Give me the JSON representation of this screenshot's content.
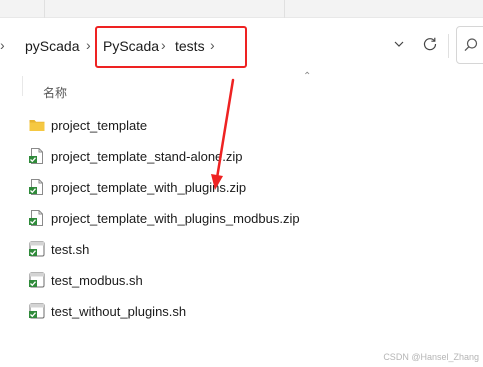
{
  "address_bar": {
    "crumbs": [
      "pyScada",
      "PyScada",
      "tests"
    ],
    "separator": "›"
  },
  "file_list": {
    "column_header": "名称",
    "items": [
      {
        "name": "project_template",
        "icon": "folder-icon"
      },
      {
        "name": "project_template_stand-alone.zip",
        "icon": "zip-archive-icon"
      },
      {
        "name": "project_template_with_plugins.zip",
        "icon": "zip-archive-icon"
      },
      {
        "name": "project_template_with_plugins_modbus.zip",
        "icon": "zip-archive-icon"
      },
      {
        "name": "test.sh",
        "icon": "shell-script-icon"
      },
      {
        "name": "test_modbus.sh",
        "icon": "shell-script-icon"
      },
      {
        "name": "test_without_plugins.sh",
        "icon": "shell-script-icon"
      }
    ]
  },
  "annotation": {
    "highlight_color": "#ee2222",
    "arrow_color": "#ee2222"
  },
  "watermark": "CSDN @Hansel_Zhang"
}
